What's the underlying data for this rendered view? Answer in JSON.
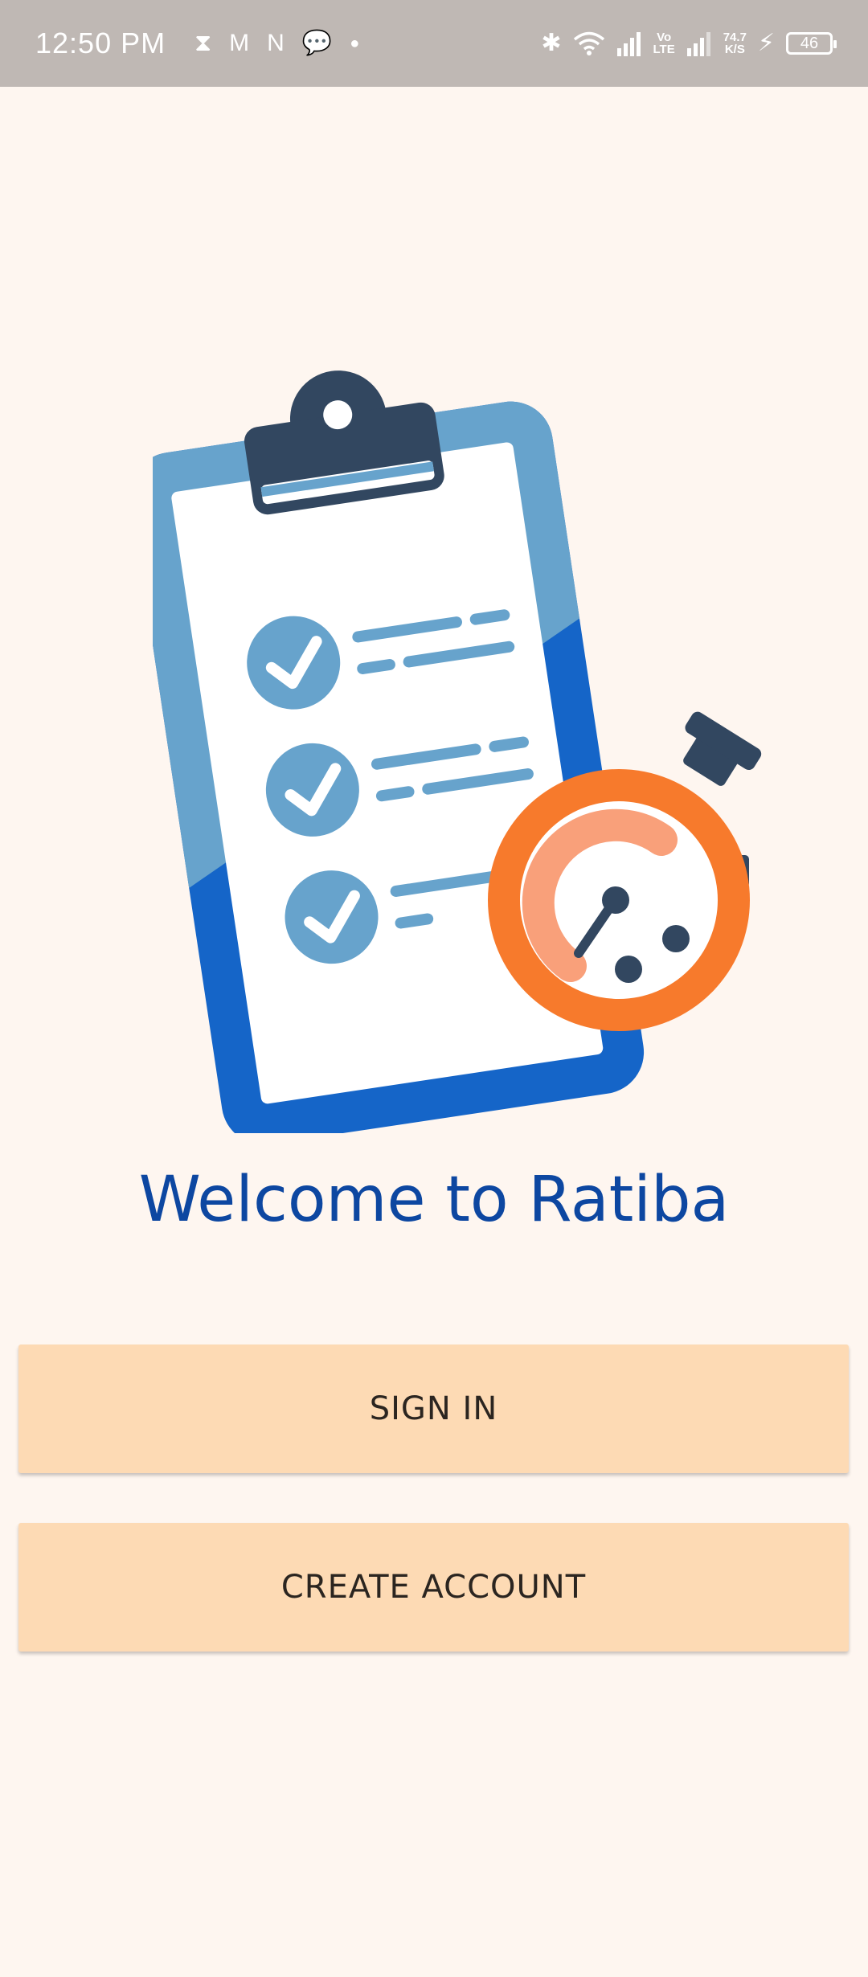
{
  "status_bar": {
    "time": "12:50 PM",
    "notifications": [
      "hourglass-icon",
      "gmail-icon",
      "netflix-icon",
      "chat-icon",
      "dot-icon"
    ],
    "volte_top": "Vo",
    "volte_bottom": "LTE",
    "net_speed_value": "74.7",
    "net_speed_unit": "K/S",
    "battery_level": "46"
  },
  "illustration": {
    "name": "Clipboard checklist with stopwatch",
    "colors": {
      "clipboard_light": "#67A3CC",
      "clipboard_dark": "#1565C8",
      "clip": "#324760",
      "stopwatch": "#F77A2C",
      "stopwatch_inner": "#F9A07A"
    }
  },
  "welcome": {
    "title": "Welcome to Ratiba"
  },
  "actions": {
    "sign_in": "SIGN IN",
    "create_account": "CREATE ACCOUNT"
  },
  "colors": {
    "background": "#FEF6F0",
    "button": "#FDDAB4",
    "title": "#0D47A1",
    "status_bar": "#BFB8B4"
  }
}
